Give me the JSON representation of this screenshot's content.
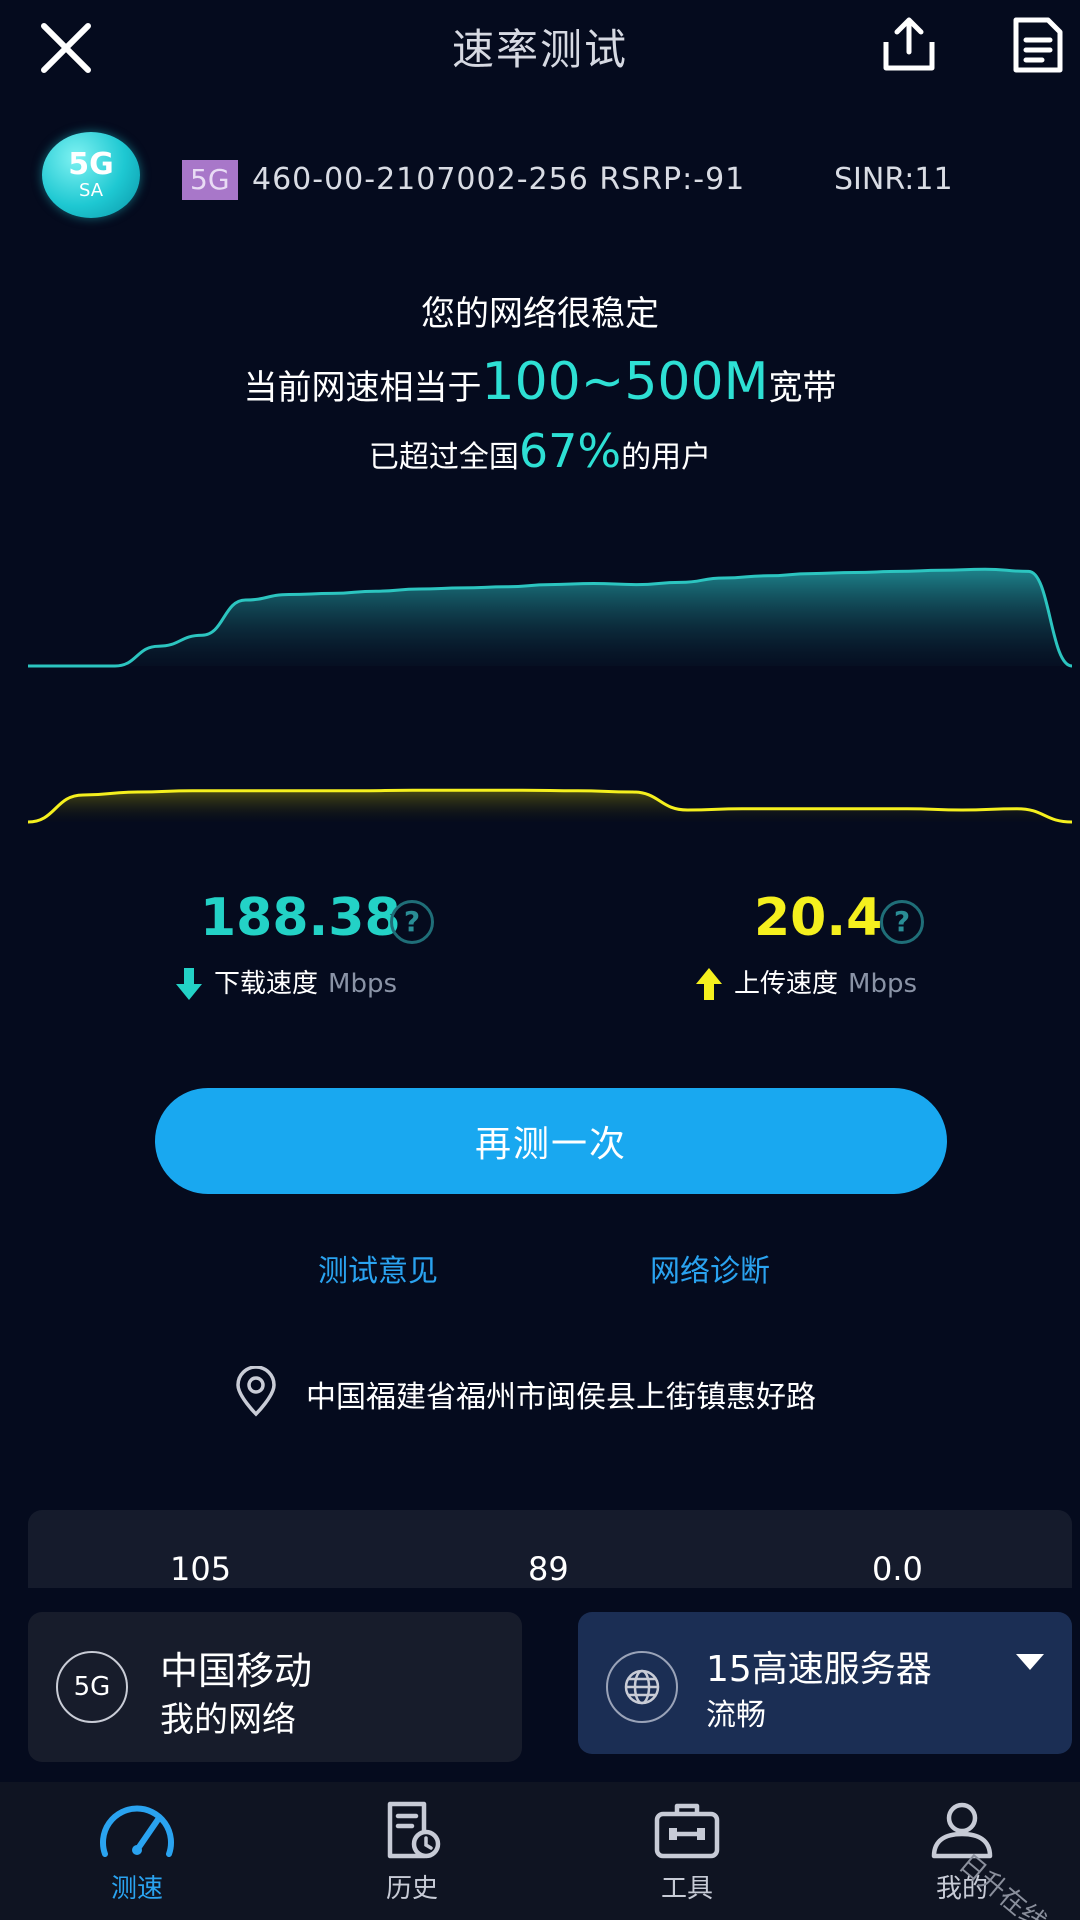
{
  "header": {
    "title": "速率测试"
  },
  "network": {
    "badge_top": "5G",
    "badge_bottom": "SA",
    "tag": "5G",
    "cell_info": "460-00-2107002-256  RSRP:-91",
    "sinr": "SINR:11"
  },
  "status": {
    "main": "您的网络很稳定",
    "line2_prefix": "当前网速相当于",
    "line2_highlight": "100~500M",
    "line2_suffix": "宽带",
    "line3_prefix": "已超过全国",
    "line3_highlight": "67%",
    "line3_suffix": "的用户"
  },
  "chart_data": {
    "type": "area",
    "series": [
      {
        "values": [
          0.0,
          0.0,
          0.0,
          0.18,
          0.28,
          0.6,
          0.65,
          0.66,
          0.68,
          0.7,
          0.71,
          0.72,
          0.74,
          0.75,
          0.74,
          0.76,
          0.8,
          0.82,
          0.84,
          0.85,
          0.86,
          0.87,
          0.88,
          0.86,
          0.0
        ],
        "color": "#2cc5c0"
      },
      {
        "values": [
          0.0,
          0.45,
          0.5,
          0.52,
          0.52,
          0.52,
          0.52,
          0.53,
          0.53,
          0.53,
          0.52,
          0.5,
          0.2,
          0.22,
          0.22,
          0.22,
          0.22,
          0.2,
          0.22,
          0.0
        ],
        "color": "#f5f01e"
      }
    ]
  },
  "speeds": {
    "download_value": "188.38",
    "download_label": "下载速度",
    "download_unit": "Mbps",
    "upload_value": "20.4",
    "upload_label": "上传速度",
    "upload_unit": "Mbps",
    "help_glyph": "?"
  },
  "actions": {
    "retest_label": "再测一次",
    "feedback_label": "测试意见",
    "diagnose_label": "网络诊断"
  },
  "location": {
    "text": "中国福建省福州市闽侯县上街镇惠好路"
  },
  "stats": [
    "105",
    "89",
    "0.0"
  ],
  "operator": {
    "badge": "5G",
    "name": "中国移动",
    "sub": "我的网络"
  },
  "server": {
    "name": "15高速服务器",
    "sub": "流畅"
  },
  "nav": {
    "items": [
      {
        "label": "测速",
        "icon": "speedometer-icon"
      },
      {
        "label": "历史",
        "icon": "history-icon"
      },
      {
        "label": "工具",
        "icon": "toolbox-icon"
      },
      {
        "label": "我的",
        "icon": "user-icon"
      }
    ]
  },
  "watermark": "日升在线",
  "colors": {
    "background": "#050b1e",
    "accent_teal": "#23d2c6",
    "accent_yellow": "#f5f01e",
    "button_blue": "#19a8f0",
    "link_blue": "#2aa3f0"
  }
}
